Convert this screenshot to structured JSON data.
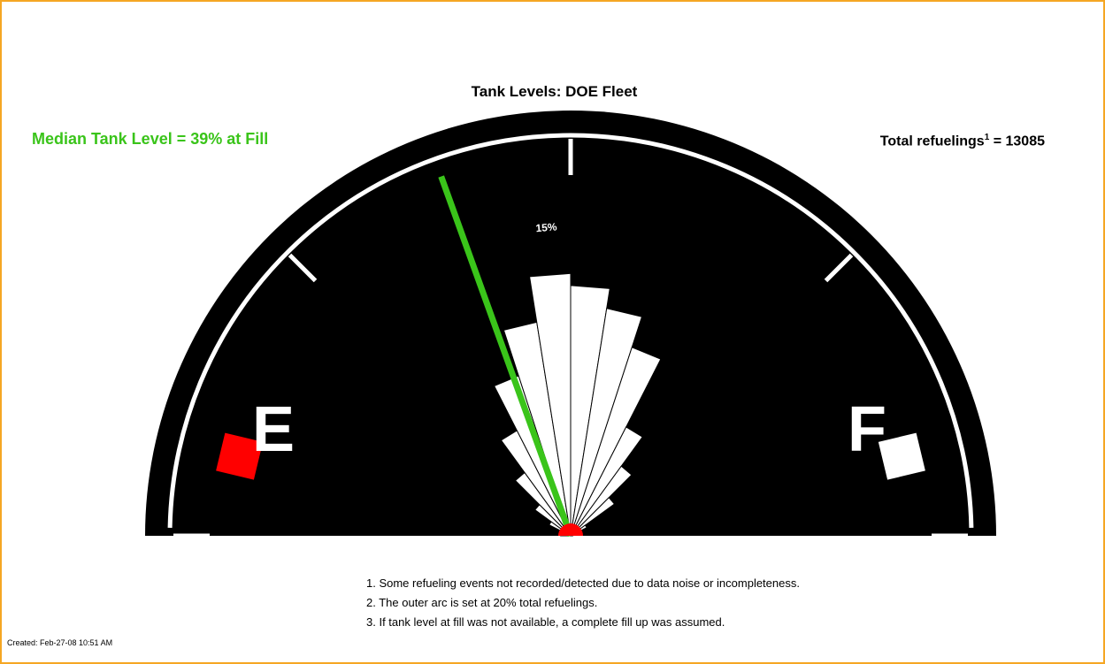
{
  "chart_data": {
    "type": "gauge-rose",
    "title": "Tank Levels: DOE Fleet",
    "median": {
      "label": "Median Tank Level = 39% at Fill",
      "value_pct": 39
    },
    "total": {
      "prefix": "Total refuelings",
      "sup": "1",
      "suffix": " = 13085",
      "value": 13085
    },
    "outer_arc_pct": 20,
    "wedge_label": "15%",
    "bins": [
      {
        "range": "0-5%",
        "pct": 0.5
      },
      {
        "range": "5-10%",
        "pct": 0.3
      },
      {
        "range": "10-15%",
        "pct": 0.4
      },
      {
        "range": "15-20%",
        "pct": 1.2
      },
      {
        "range": "20-25%",
        "pct": 2.2
      },
      {
        "range": "25-30%",
        "pct": 3.9
      },
      {
        "range": "30-35%",
        "pct": 5.9
      },
      {
        "range": "35-40%",
        "pct": 8.4
      },
      {
        "range": "40-45%",
        "pct": 10.8
      },
      {
        "range": "45-50%",
        "pct": 13.1
      },
      {
        "range": "50-55%",
        "pct": 12.5
      },
      {
        "range": "55-60%",
        "pct": 11.5
      },
      {
        "range": "60-65%",
        "pct": 9.9
      },
      {
        "range": "65-70%",
        "pct": 6.1
      },
      {
        "range": "70-75%",
        "pct": 4.3
      },
      {
        "range": "75-80%",
        "pct": 2.7
      },
      {
        "range": "80-85%",
        "pct": 0.9
      },
      {
        "range": "85-90%",
        "pct": 0.4
      },
      {
        "range": "90-95%",
        "pct": 0.2
      },
      {
        "range": "95-100%",
        "pct": 0.1
      }
    ],
    "tick_pcts": [
      0,
      25,
      50,
      75,
      100
    ],
    "empty_label": "E",
    "full_label": "F"
  },
  "notes": [
    "1. Some refueling events not recorded/detected due to data noise or incompleteness.",
    "2. The outer arc is set at 20% total refuelings.",
    "3. If tank level at fill was not available, a complete fill up was assumed."
  ],
  "created": "Created: Feb-27-08 10:51 AM",
  "colors": {
    "background": "#ffffff",
    "frame": "#f5a623",
    "gauge": "#000000",
    "wedge": "#ffffff",
    "needle": "#3ac41a",
    "median_text": "#3ac41a",
    "empty_marker": "#ff0000",
    "full_marker": "#ffffff",
    "hub": "#ff0000"
  }
}
